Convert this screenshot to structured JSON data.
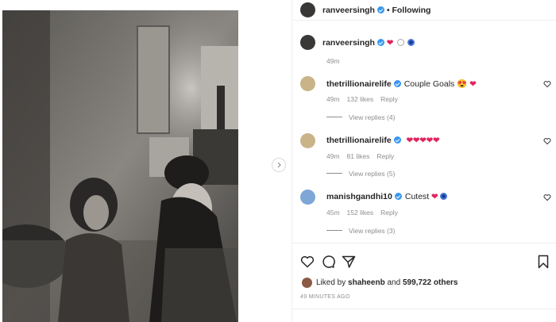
{
  "header": {
    "username": "ranveersingh",
    "separator": "•",
    "follow_status": "Following"
  },
  "caption": {
    "username": "ranveersingh",
    "emoji": "❤",
    "time": "49m"
  },
  "comments": [
    {
      "username": "thetrillionairelife",
      "text": "Couple Goals 😍",
      "hearts": "❤",
      "time": "49m",
      "likes": "132 likes",
      "reply": "Reply",
      "view_replies": "View replies (4)"
    },
    {
      "username": "thetrillionairelife",
      "text": "",
      "hearts": "❤❤❤❤❤",
      "time": "49m",
      "likes": "81 likes",
      "reply": "Reply",
      "view_replies": "View replies (5)"
    },
    {
      "username": "manishgandhi10",
      "text": "Cutest",
      "hearts": "❤",
      "time": "45m",
      "likes": "152 likes",
      "reply": "Reply",
      "view_replies": "View replies (3)"
    }
  ],
  "likes_summary": {
    "prefix": "Liked by",
    "user": "shaheenb",
    "mid": "and",
    "others": "599,722 others"
  },
  "timestamp": "49 MINUTES AGO",
  "icons": {
    "like": "heart-icon",
    "comment": "comment-icon",
    "share": "share-icon",
    "save": "bookmark-icon",
    "next": "chevron-right-icon"
  },
  "colors": {
    "verified": "#3897f0",
    "heart": "#e0245e",
    "muted": "#8e8e8e"
  }
}
